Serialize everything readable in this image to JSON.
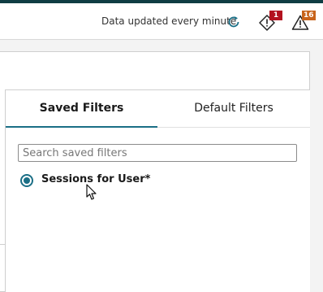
{
  "header": {
    "status_text": "Data updated every minute",
    "refresh_icon": "refresh-icon",
    "alerts": [
      {
        "icon": "warning-diamond-icon",
        "count": "1",
        "color": "#b3121f"
      },
      {
        "icon": "warning-triangle-icon",
        "count": "16",
        "color": "#c8641c"
      }
    ]
  },
  "filters_panel": {
    "tabs": [
      {
        "label": "Saved Filters",
        "active": true
      },
      {
        "label": "Default Filters",
        "active": false
      }
    ],
    "search": {
      "placeholder": "Search saved filters",
      "value": ""
    },
    "saved_filters": [
      {
        "label": "Sessions for User*",
        "selected": true
      }
    ]
  },
  "colors": {
    "accent": "#1b6f86",
    "topbar": "#0f3d43"
  }
}
